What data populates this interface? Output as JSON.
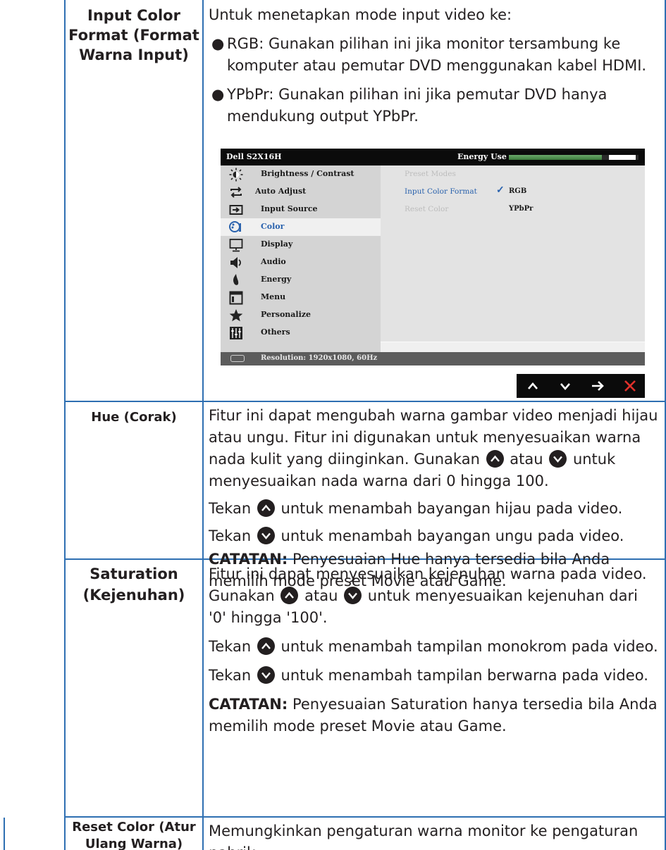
{
  "rows": [
    {
      "label": "Input Color Format (Format Warna Input)",
      "intro": "Untuk menetapkan mode input video ke:",
      "bullet1": "RGB: Gunakan pilihan ini jika monitor tersambung ke komputer atau pemutar DVD menggunakan kabel HDMI.",
      "bullet2": "YPbPr: Gunakan pilihan ini jika pemutar DVD hanya mendukung output YPbPr."
    },
    {
      "label": "Hue (Corak)",
      "p1a": "Fitur ini dapat mengubah warna gambar video menjadi hijau atau ungu. Fitur ini digunakan untuk menyesuaikan warna nada kulit yang diinginkan. Gunakan",
      "p1b": "atau",
      "p1c": "untuk menyesuaikan nada warna dari 0 hingga 100.",
      "p2a": "Tekan",
      "p2b": "untuk menambah bayangan hijau pada video.",
      "p3a": "Tekan",
      "p3b": "untuk menambah bayangan ungu pada video.",
      "note_label": "CATATAN:",
      "note": "Penyesuaian Hue hanya tersedia bila Anda memilih mode preset Movie atau Game."
    },
    {
      "label": "Saturation (Kejenuhan)",
      "p1": "Fitur ini dapat menyesuaikan kejenuhan warna pada video.",
      "p2a": "Gunakan",
      "p2b": "atau",
      "p2c": "untuk menyesuaikan kejenuhan dari '0' hingga '100'.",
      "p3a": "Tekan",
      "p3b": "untuk menambah tampilan monokrom pada video.",
      "p4a": "Tekan",
      "p4b": "untuk menambah tampilan berwarna pada video.",
      "note_label": "CATATAN:",
      "note": "Penyesuaian Saturation hanya tersedia bila Anda memilih mode preset Movie atau Game."
    },
    {
      "label": "Reset Color (Atur Ulang Warna)",
      "text": "Memungkinkan pengaturan warna monitor ke pengaturan pabrik."
    }
  ],
  "osd": {
    "title": "Dell S2X16H",
    "energy_label": "Energy Use",
    "energy_level": 0.72,
    "menu": [
      {
        "label": "Brightness / Contrast",
        "icon": "brightness-icon"
      },
      {
        "label": "Auto Adjust",
        "icon": "auto-adjust-icon"
      },
      {
        "label": "Input Source",
        "icon": "input-source-icon"
      },
      {
        "label": "Color",
        "icon": "color-icon",
        "selected": true
      },
      {
        "label": "Display",
        "icon": "display-icon"
      },
      {
        "label": "Audio",
        "icon": "audio-icon"
      },
      {
        "label": "Energy",
        "icon": "energy-icon"
      },
      {
        "label": "Menu",
        "icon": "menu-icon"
      },
      {
        "label": "Personalize",
        "icon": "personalize-icon"
      },
      {
        "label": "Others",
        "icon": "others-icon"
      }
    ],
    "submenu": [
      {
        "label": "Preset Modes",
        "state": "disabled"
      },
      {
        "label": "Input Color Format",
        "state": "active",
        "value": "RGB",
        "checked": true
      },
      {
        "label": "Reset Color",
        "state": "disabled",
        "value": "YPbPr"
      }
    ],
    "resolution": "Resolution: 1920x1080, 60Hz",
    "buttons": [
      "up-arrow-icon",
      "down-arrow-icon",
      "right-arrow-icon",
      "close-icon"
    ]
  },
  "colors": {
    "rule": "#2e6fb2",
    "text": "#231f20",
    "active": "#2a62ad",
    "close": "#e0312b"
  }
}
